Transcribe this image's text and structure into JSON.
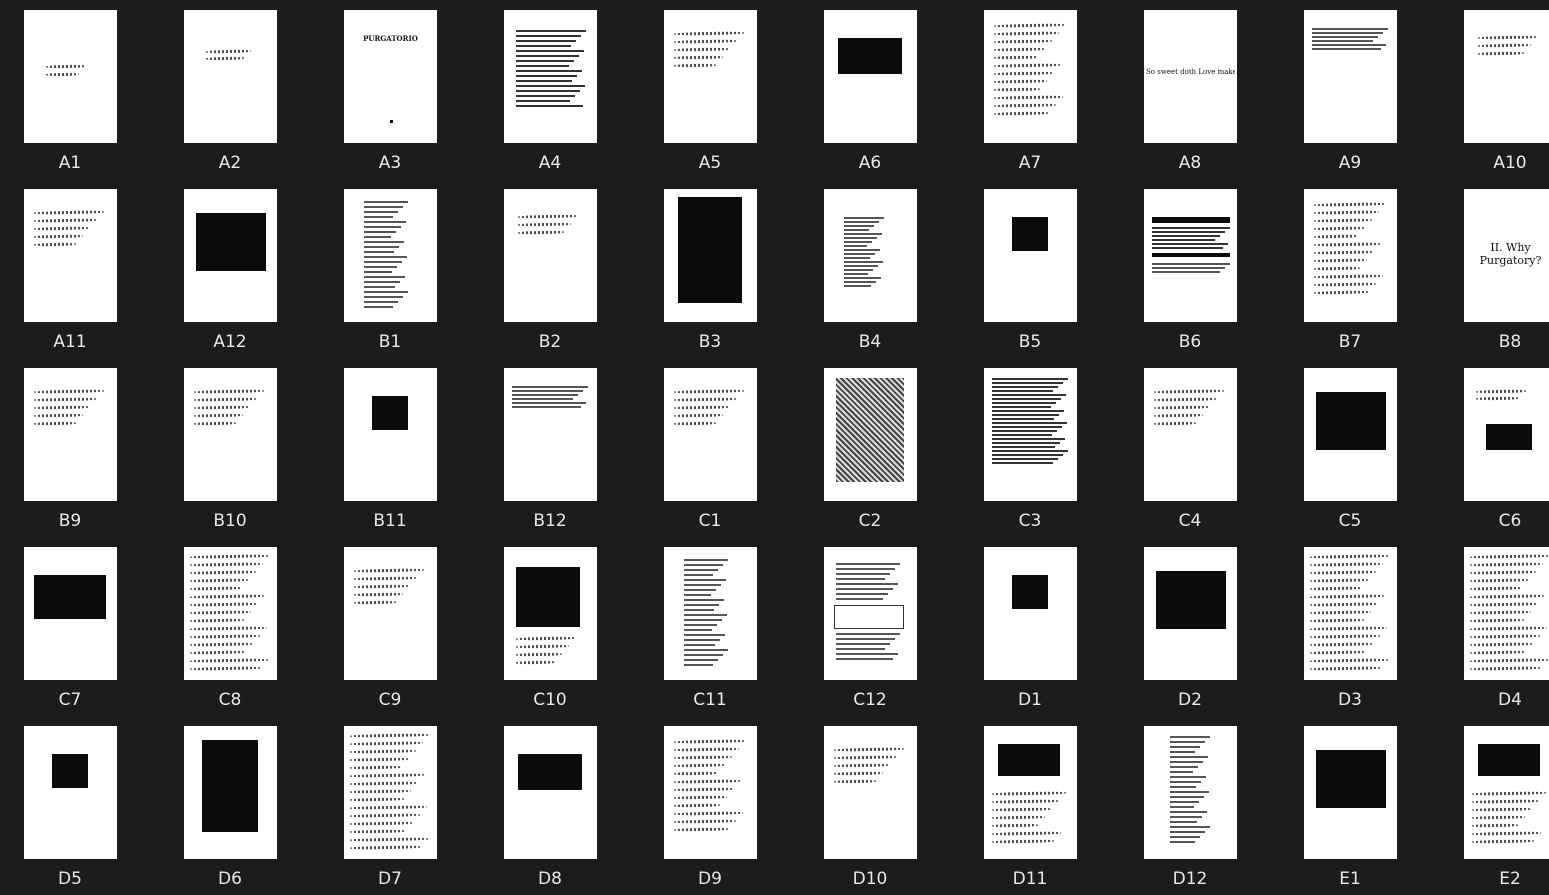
{
  "tiles": [
    {
      "label": "A1",
      "kind": "hw-short"
    },
    {
      "label": "A2",
      "kind": "hw-center"
    },
    {
      "label": "A3",
      "kind": "title",
      "title": "PURGATORIO"
    },
    {
      "label": "A4",
      "kind": "printed-poem"
    },
    {
      "label": "A5",
      "kind": "hw-top"
    },
    {
      "label": "A6",
      "kind": "image-top-small"
    },
    {
      "label": "A7",
      "kind": "hw-full"
    },
    {
      "label": "A8",
      "kind": "bigtext",
      "title": "So sweet doth Love make himself feel to me,"
    },
    {
      "label": "A9",
      "kind": "printed-top"
    },
    {
      "label": "A10",
      "kind": "hw-top-small"
    },
    {
      "label": "A11",
      "kind": "hw-top"
    },
    {
      "label": "A12",
      "kind": "image-mid"
    },
    {
      "label": "B1",
      "kind": "printed-column"
    },
    {
      "label": "B2",
      "kind": "hw-top-small"
    },
    {
      "label": "B3",
      "kind": "image-painting"
    },
    {
      "label": "B4",
      "kind": "printed-list"
    },
    {
      "label": "B5",
      "kind": "image-tiny"
    },
    {
      "label": "B6",
      "kind": "printed-redacted"
    },
    {
      "label": "B7",
      "kind": "hw-full"
    },
    {
      "label": "B8",
      "kind": "title-big",
      "title": "II. Why Purgatory?"
    },
    {
      "label": "B9",
      "kind": "hw-top"
    },
    {
      "label": "B10",
      "kind": "hw-top"
    },
    {
      "label": "B11",
      "kind": "image-tiny"
    },
    {
      "label": "B12",
      "kind": "printed-top"
    },
    {
      "label": "C1",
      "kind": "hw-top"
    },
    {
      "label": "C2",
      "kind": "image-engraving"
    },
    {
      "label": "C3",
      "kind": "printed-block"
    },
    {
      "label": "C4",
      "kind": "hw-top"
    },
    {
      "label": "C5",
      "kind": "image-mid"
    },
    {
      "label": "C6",
      "kind": "image-tiny-hw"
    },
    {
      "label": "C7",
      "kind": "image-mid-small"
    },
    {
      "label": "C8",
      "kind": "hw-dense"
    },
    {
      "label": "C9",
      "kind": "hw-top"
    },
    {
      "label": "C10",
      "kind": "image-large-hw"
    },
    {
      "label": "C11",
      "kind": "printed-column"
    },
    {
      "label": "C12",
      "kind": "printed-boxed"
    },
    {
      "label": "D1",
      "kind": "image-tiny"
    },
    {
      "label": "D2",
      "kind": "image-mid"
    },
    {
      "label": "D3",
      "kind": "hw-dense"
    },
    {
      "label": "D4",
      "kind": "hw-dense"
    },
    {
      "label": "D5",
      "kind": "image-tiny"
    },
    {
      "label": "D6",
      "kind": "image-tall"
    },
    {
      "label": "D7",
      "kind": "hw-dense"
    },
    {
      "label": "D8",
      "kind": "image-top-small"
    },
    {
      "label": "D9",
      "kind": "hw-full"
    },
    {
      "label": "D10",
      "kind": "hw-top"
    },
    {
      "label": "D11",
      "kind": "image-top-hw"
    },
    {
      "label": "D12",
      "kind": "printed-centered"
    },
    {
      "label": "E1",
      "kind": "image-mid"
    },
    {
      "label": "E2",
      "kind": "image-top-hw"
    }
  ]
}
